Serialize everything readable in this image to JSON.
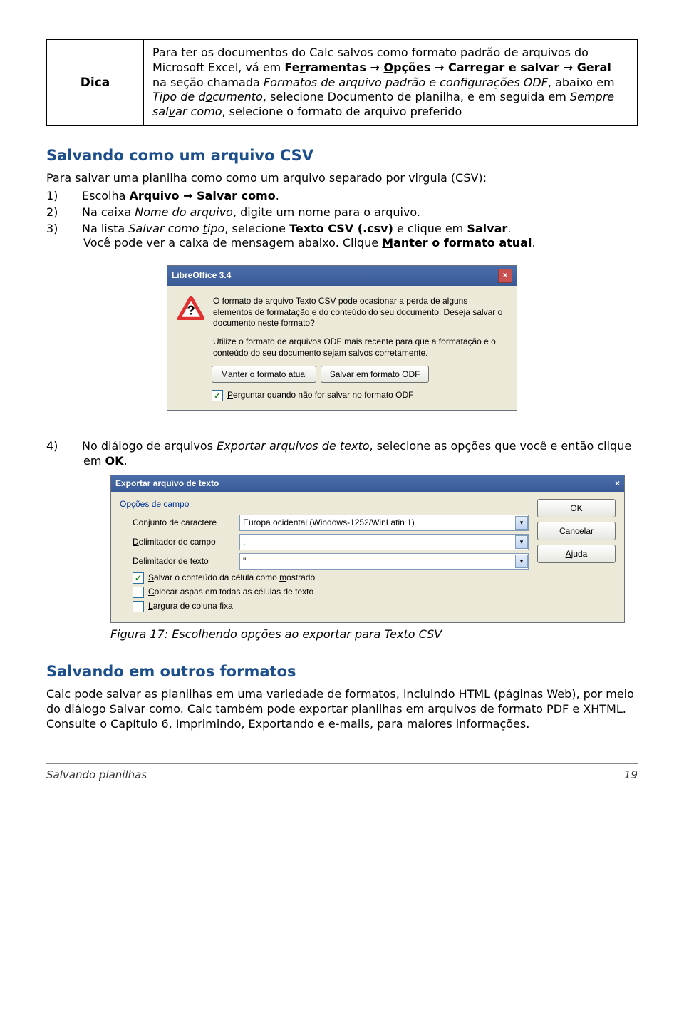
{
  "tip": {
    "label": "Dica",
    "text_full": "Para ter os documentos do Calc salvos como formato padrão de arquivos do Microsoft Excel, vá em Fe",
    "text_seg1": "Para ter os documentos do Calc salvos como formato padrão de arquivos do Microsoft Excel, vá em ",
    "bold1a": "Fe",
    "u1a": "r",
    "bold1b": "ramentas → ",
    "u1b": "O",
    "bold1c": "pções → Carregar e salvar → Geral",
    "seg2": " na seção chamada ",
    "ital1": "Formatos de arquivo padrão e configurações ODF",
    "seg3": ", abaixo em ",
    "ital2a": "Tipo de d",
    "ital2u": "o",
    "ital2b": "cumento",
    "seg4": ", selecione Documento de planilha, e em seguida em ",
    "ital3a": "Sempre sal",
    "ital3u": "v",
    "ital3b": "ar como",
    "seg5": ", selecione o formato de arquivo preferido"
  },
  "h_csv": "Salvando como um arquivo CSV",
  "p_csv_intro": "Para salvar uma planilha como como um arquivo separado por virgula (CSV):",
  "steps_csv": {
    "s1a": "1)",
    "s1b": "Escolha ",
    "s1bold": "Arquivo → Salvar como",
    "s1c": ".",
    "s2a": "2)",
    "s2b": "Na caixa ",
    "s2iu": "N",
    "s2i": "ome do arquivo",
    "s2c": ", digite um nome para o arquivo.",
    "s3a": "3)",
    "s3b": "Na lista ",
    "s3i1": "Salvar como ",
    "s3iu": "t",
    "s3i2": "ipo",
    "s3c": ", selecione ",
    "s3bold1": "Texto CSV (.csv)",
    "s3d": " e clique em ",
    "s3bold2": "Salvar",
    "s3e": ".",
    "s3line2a": "Você pode ver a caixa de mensagem abaixo. Clique ",
    "s3line2u": "M",
    "s3line2bold": "anter o formato atual",
    "s3line2b": "."
  },
  "dialog1": {
    "title": "LibreOffice 3.4",
    "msg1": "O formato de arquivo Texto CSV pode ocasionar a perda de alguns elementos de formatação e do conteúdo do seu documento. Deseja salvar o documento neste formato?",
    "msg2": "Utilize o formato de arquivos ODF mais recente para que a formatação e o conteúdo do seu documento sejam salvos corretamente.",
    "btn_keep_u": "M",
    "btn_keep": "anter o formato atual",
    "btn_odf_u": "S",
    "btn_odf": "alvar em formato ODF",
    "cb_u": "P",
    "cb": "erguntar quando não for salvar no formato ODF"
  },
  "step4": {
    "num": "4)",
    "a": "No diálogo de arquivos ",
    "i": "Exportar arquivos de texto",
    "b": ", selecione as opções que você e então clique em ",
    "bold": "OK",
    "c": "."
  },
  "dialog2": {
    "title": "Exportar arquivo de texto",
    "legend": "Opções de campo",
    "lbl_charset": "Conjunto de caractere",
    "val_charset": "Europa ocidental (Windows-1252/WinLatin 1)",
    "lbl_field_u": "D",
    "lbl_field": "elimitador de campo",
    "val_field": ",",
    "lbl_text": "Delimitador de te",
    "lbl_text_u": "x",
    "lbl_text2": "to",
    "val_text": "\"",
    "cb1_u": "S",
    "cb1a": "alvar o conteúdo da célula como ",
    "cb1_u2": "m",
    "cb1b": "ostrado",
    "cb2_u": "C",
    "cb2": "olocar aspas em todas as células de texto",
    "cb3_u": "L",
    "cb3": "argura de coluna fixa",
    "btn_ok": "OK",
    "btn_cancel": "Cancelar",
    "btn_help_u": "A",
    "btn_help": "juda"
  },
  "caption": "Figura 17: Escolhendo opções ao exportar para Texto CSV",
  "h_other": "Salvando em outros formatos",
  "p_other_a": "Calc pode salvar as planilhas em uma variedade de formatos, incluindo HTML (páginas Web), por meio do diálogo Sal",
  "p_other_u": "v",
  "p_other_b": "ar como. Calc também pode exportar planilhas em arquivos de formato PDF e XHTML. Consulte o Capítulo 6, Imprimindo, Exportando e e-mails, para maiores informações.",
  "footer": {
    "left": "Salvando planilhas",
    "right": "19"
  }
}
